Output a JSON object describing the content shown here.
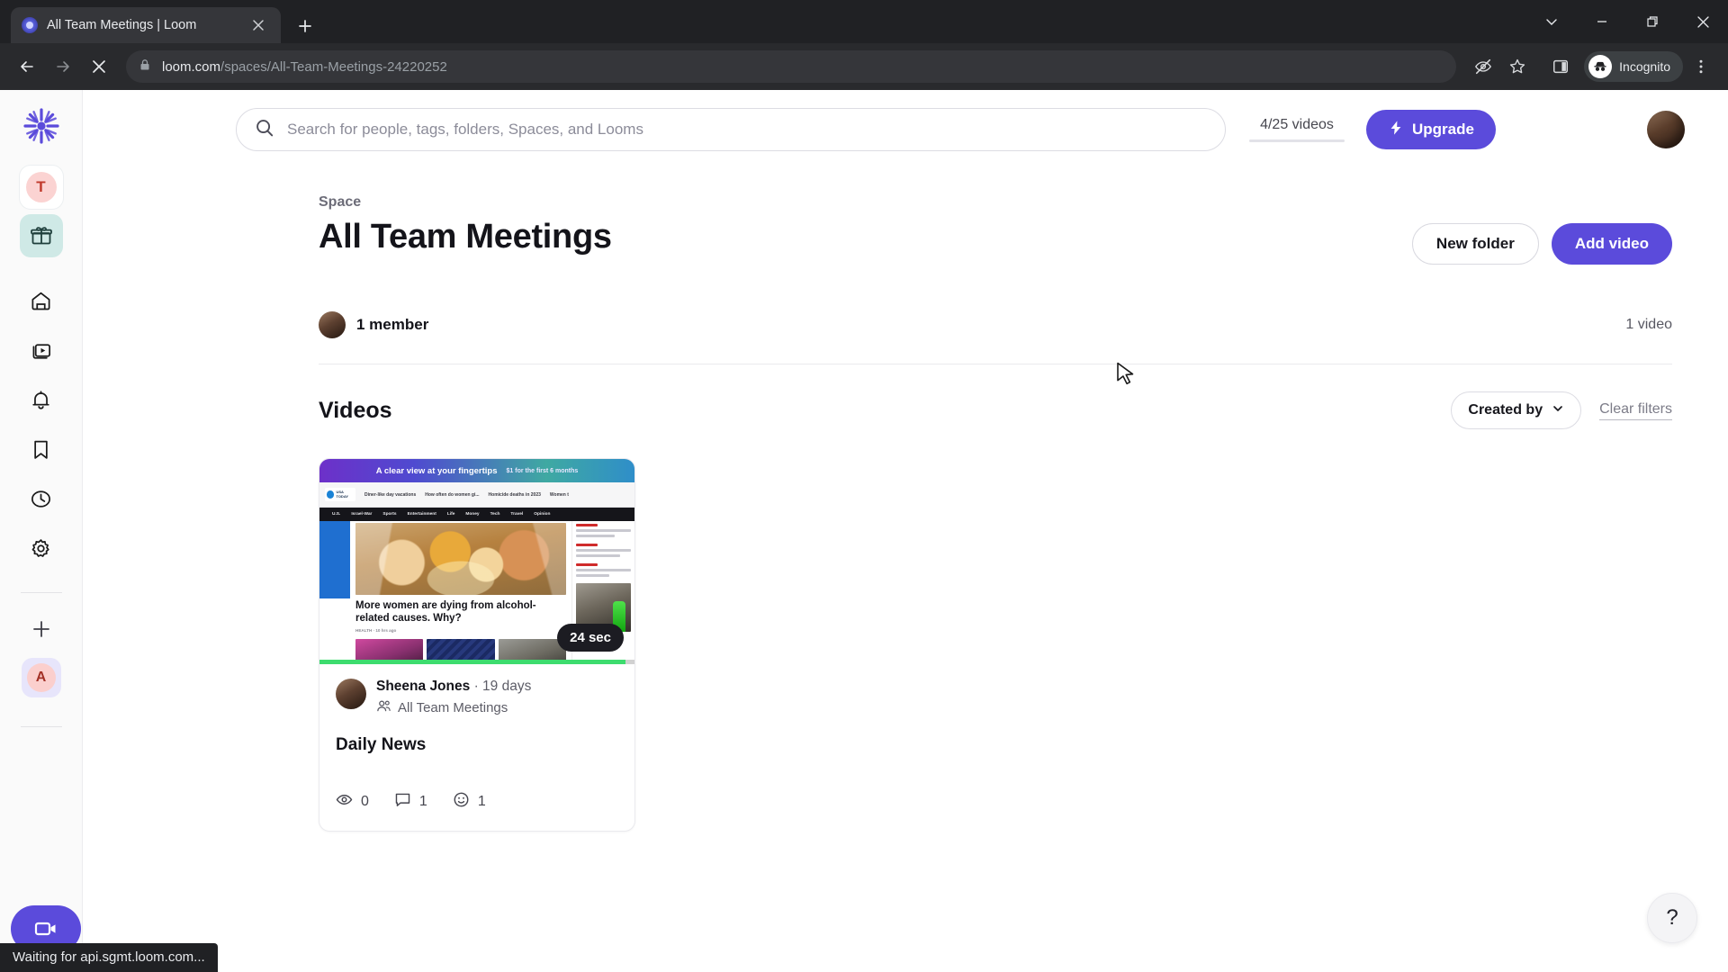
{
  "browser": {
    "tab": {
      "title": "All Team Meetings | Loom",
      "favicon": "loom-favicon-icon",
      "close": "×",
      "newtab": "+"
    },
    "window": {
      "chevron": "⌄",
      "minimize": "—",
      "maximize": "❐",
      "close": "✕"
    },
    "toolbar": {
      "back": "←",
      "forward": "→",
      "stop": "✕",
      "url_domain": "loom.com",
      "url_path": "/spaces/All-Team-Meetings-24220252",
      "lock_icon": "lock-icon",
      "eye_off_icon": "eye-off-icon",
      "bookmark_icon": "star-icon",
      "side_panel_icon": "side-panel-icon",
      "profile_label": "Incognito",
      "menu_icon": "kebab-menu-icon"
    }
  },
  "rail": {
    "logo": "loom-logo-icon",
    "workspace_initial": "T",
    "gift_icon": "gift-icon",
    "items": [
      {
        "name": "home",
        "icon": "home-icon"
      },
      {
        "name": "library",
        "icon": "library-icon"
      },
      {
        "name": "notifications",
        "icon": "bell-icon"
      },
      {
        "name": "bookmarks",
        "icon": "bookmark-icon"
      },
      {
        "name": "history",
        "icon": "clock-icon"
      },
      {
        "name": "settings",
        "icon": "gear-icon"
      }
    ],
    "add": "+",
    "account_initial": "A",
    "record_icon": "video-camera-icon"
  },
  "topbar": {
    "search_placeholder": "Search for people, tags, folders, Spaces, and Looms",
    "search_value": "",
    "search_icon": "search-icon",
    "quota_label": "4/25 videos",
    "quota_used": 4,
    "quota_total": 25,
    "upgrade_label": "Upgrade",
    "upgrade_icon": "lightning-bolt-icon",
    "avatar": "user-avatar"
  },
  "space": {
    "kicker": "Space",
    "title": "All Team Meetings",
    "new_folder_label": "New folder",
    "add_video_label": "Add video",
    "member_label": "1 member",
    "video_count": "1 video"
  },
  "videos_section": {
    "heading": "Videos",
    "created_by_label": "Created by",
    "chevron_icon": "chevron-down-icon",
    "clear_filters_label": "Clear filters"
  },
  "video_card": {
    "duration": "24 sec",
    "author": "Sheena Jones",
    "separator": "·",
    "age": "19 days",
    "space_name": "All Team Meetings",
    "space_icon": "people-icon",
    "title": "Daily News",
    "views_icon": "eye-icon",
    "views": "0",
    "comments_icon": "comment-icon",
    "comments": "1",
    "reactions_icon": "emoji-icon",
    "reactions": "1",
    "thumbnail": {
      "banner_main": "A clear view at your fingertips",
      "banner_sub": "$1 for the first 6 months",
      "site_name": "USA TODAY",
      "nav_items": [
        "U.S.",
        "Israel-War",
        "Sports",
        "Entertainment",
        "Life",
        "Money",
        "Tech",
        "Travel",
        "Opinion"
      ],
      "teasers": [
        "Diner-like day vacations",
        "How often do women gi...",
        "Homicide deaths in 2023",
        "Women t"
      ],
      "headline": "More women are dying from alcohol-related causes. Why?",
      "byline": "HEALTH  ·  10 hrs ago"
    }
  },
  "overlays": {
    "help_label": "?",
    "status_text": "Waiting for api.sgmt.loom.com..."
  },
  "colors": {
    "brand_purple": "#5b4bdb",
    "chrome_dark": "#202124",
    "text_primary": "#14141a"
  }
}
